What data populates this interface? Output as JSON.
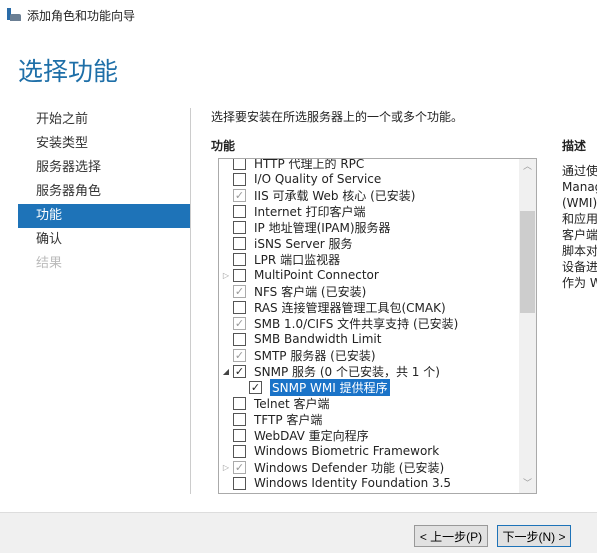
{
  "window": {
    "title": "添加角色和功能向导",
    "icon": "server-manager-icon"
  },
  "page_title": "选择功能",
  "nav": [
    {
      "label": "开始之前",
      "state": "normal"
    },
    {
      "label": "安装类型",
      "state": "normal"
    },
    {
      "label": "服务器选择",
      "state": "normal"
    },
    {
      "label": "服务器角色",
      "state": "normal"
    },
    {
      "label": "功能",
      "state": "active"
    },
    {
      "label": "确认",
      "state": "normal"
    },
    {
      "label": "结果",
      "state": "disabled"
    }
  ],
  "instruction": "选择要安装在所选服务器上的一个或多个功能。",
  "features_header": "功能",
  "features": [
    {
      "label": "HTTP 代理上的 RPC",
      "state": "unchecked",
      "expander": ""
    },
    {
      "label": "I/O Quality of Service",
      "state": "unchecked",
      "expander": ""
    },
    {
      "label": "IIS 可承载 Web 核心 (已安装)",
      "state": "installed",
      "expander": ""
    },
    {
      "label": "Internet 打印客户端",
      "state": "unchecked",
      "expander": ""
    },
    {
      "label": "IP 地址管理(IPAM)服务器",
      "state": "unchecked",
      "expander": ""
    },
    {
      "label": "iSNS Server 服务",
      "state": "unchecked",
      "expander": ""
    },
    {
      "label": "LPR 端口监视器",
      "state": "unchecked",
      "expander": ""
    },
    {
      "label": "MultiPoint Connector",
      "state": "unchecked",
      "expander": "collapsed"
    },
    {
      "label": "NFS 客户端 (已安装)",
      "state": "installed",
      "expander": ""
    },
    {
      "label": "RAS 连接管理器管理工具包(CMAK)",
      "state": "unchecked",
      "expander": ""
    },
    {
      "label": "SMB 1.0/CIFS 文件共享支持 (已安装)",
      "state": "installed",
      "expander": ""
    },
    {
      "label": "SMB Bandwidth Limit",
      "state": "unchecked",
      "expander": ""
    },
    {
      "label": "SMTP 服务器 (已安装)",
      "state": "installed",
      "expander": ""
    },
    {
      "label": "SNMP 服务 (0 个已安装，共 1 个)",
      "state": "checked",
      "expander": "expanded"
    },
    {
      "label": "SNMP WMI 提供程序",
      "state": "checked",
      "expander": "",
      "child": true,
      "selected": true
    },
    {
      "label": "Telnet 客户端",
      "state": "unchecked",
      "expander": ""
    },
    {
      "label": "TFTP 客户端",
      "state": "unchecked",
      "expander": ""
    },
    {
      "label": "WebDAV 重定向程序",
      "state": "unchecked",
      "expander": ""
    },
    {
      "label": "Windows Biometric Framework",
      "state": "unchecked",
      "expander": ""
    },
    {
      "label": "Windows Defender 功能 (已安装)",
      "state": "installed",
      "expander": "collapsed"
    },
    {
      "label": "Windows Identity Foundation 3.5",
      "state": "unchecked",
      "expander": ""
    }
  ],
  "description_header": "描述",
  "description_lines": [
    "通过使",
    "Manag",
    "(WMI)",
    "和应用",
    "客户端",
    "脚本对",
    "设备进",
    "作为 W"
  ],
  "buttons": {
    "previous": "< 上一步(P)",
    "next": "下一步(N) >"
  },
  "colors": {
    "accent": "#1e73b8",
    "title": "#1e6fa8"
  }
}
